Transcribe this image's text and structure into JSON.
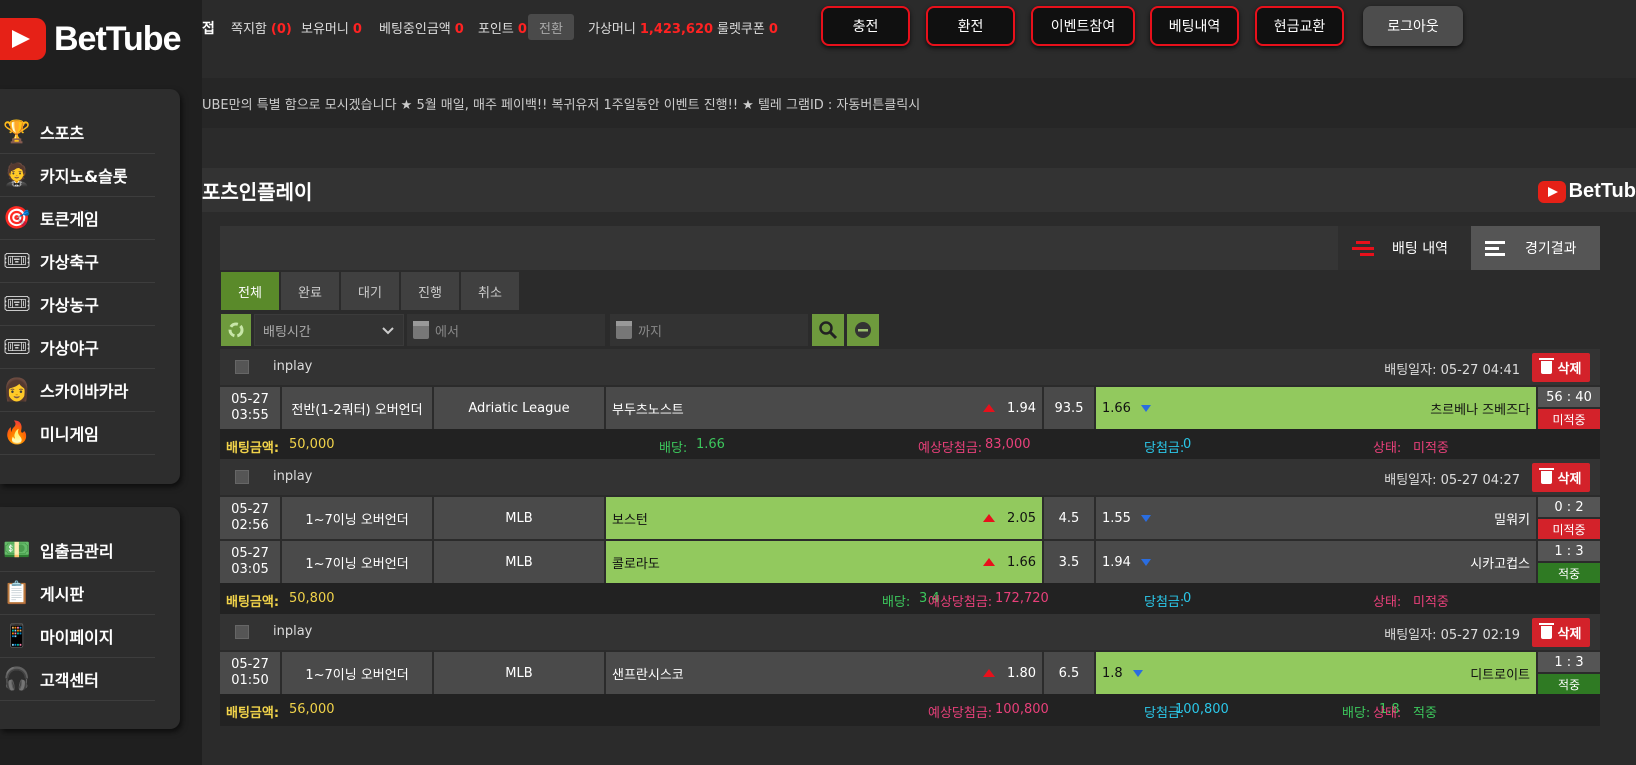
{
  "brand": {
    "logo_text": "BetTube",
    "mini_logo_text": "BetTub"
  },
  "sidebar": {
    "main": [
      {
        "label": "스포츠",
        "icon": "trophy-icon",
        "glyph": "🏆"
      },
      {
        "label": "카지노&슬롯",
        "icon": "dealer-icon",
        "glyph": "🤵"
      },
      {
        "label": "토큰게임",
        "icon": "target-icon",
        "glyph": "🎯"
      },
      {
        "label": "가상축구",
        "icon": "ticket-icon",
        "glyph": "🎟"
      },
      {
        "label": "가상농구",
        "icon": "ticket-icon",
        "glyph": "🎟"
      },
      {
        "label": "가상야구",
        "icon": "ticket-icon",
        "glyph": "🎟"
      },
      {
        "label": "스카이바카라",
        "icon": "avatar-icon",
        "glyph": "👩"
      },
      {
        "label": "미니게임",
        "icon": "flame-icon",
        "glyph": "🔥"
      }
    ],
    "sub": [
      {
        "label": "입출금관리",
        "icon": "money-icon",
        "glyph": "💵"
      },
      {
        "label": "게시판",
        "icon": "board-icon",
        "glyph": "📋"
      },
      {
        "label": "마이페이지",
        "icon": "phone-icon",
        "glyph": "📱"
      },
      {
        "label": "고객센터",
        "icon": "support-icon",
        "glyph": "🎧"
      }
    ]
  },
  "topbar": {
    "cut_label": "접",
    "messages_label": "쪽지함",
    "messages_value": "(0)",
    "money_label": "보유머니",
    "money_value": "0",
    "betting_label": "베팅중인금액",
    "betting_value": "0",
    "points_label": "포인트",
    "points_value": "0",
    "convert_label": "전환",
    "virtual_label": "가상머니",
    "virtual_value": "1,423,620",
    "coupon_label": "룰렛쿠폰",
    "coupon_value": "0",
    "buttons": [
      "충전",
      "환전",
      "이벤트참여",
      "베팅내역",
      "현금교환"
    ],
    "logout_label": "로그아웃"
  },
  "ticker": {
    "text": "UBE만의 특별 함으로 모시겠습니다 ★ 5월 매일, 매주 페이백!! 복귀유저 1주일동안 이벤트 진행!! ★ 텔레 그램ID : 자동버튼클릭시"
  },
  "page": {
    "title": "포츠인플레이"
  },
  "history": {
    "bet_history_label": "배팅 내역",
    "results_label": "경기결과"
  },
  "tabs": [
    "전체",
    "완료",
    "대기",
    "진행",
    "취소"
  ],
  "filter": {
    "select_value": "배팅시간",
    "from_placeholder": "에서",
    "to_placeholder": "까지"
  },
  "labels": {
    "inplay": "inplay",
    "delete": "삭제",
    "amount": "배팅금액:",
    "odds": "배당:",
    "expected": "예상당첨금:",
    "won": "당첨금:",
    "status": "상태:"
  },
  "bets": [
    {
      "date": "배팅일자: 05-27 04:41",
      "games": [
        {
          "time_date": "05-27",
          "time_clock": "03:55",
          "type": "전반(1-2쿼터) 오버언더",
          "league": "Adriatic League",
          "home": "부두츠노스트",
          "home_odd": "1.94",
          "line": "93.5",
          "away_odd": "1.66",
          "away": "츠르베나 즈베즈다",
          "pick": "away",
          "score": "56 : 40",
          "status": "미적중",
          "status_color": "red"
        }
      ],
      "amount": "50,000",
      "odds": "1.66",
      "expected": "83,000",
      "won": "0",
      "status": "미적중",
      "status_color": "#e8407a"
    },
    {
      "date": "배팅일자: 05-27 04:27",
      "games": [
        {
          "time_date": "05-27",
          "time_clock": "02:56",
          "type": "1~7이닝 오버언더",
          "league": "MLB",
          "home": "보스턴",
          "home_odd": "2.05",
          "line": "4.5",
          "away_odd": "1.55",
          "away": "밀워키",
          "pick": "home",
          "score": "0 : 2",
          "status": "미적중",
          "status_color": "red"
        },
        {
          "time_date": "05-27",
          "time_clock": "03:05",
          "type": "1~7이닝 오버언더",
          "league": "MLB",
          "home": "콜로라도",
          "home_odd": "1.66",
          "line": "3.5",
          "away_odd": "1.94",
          "away": "시카고컵스",
          "pick": "home",
          "score": "1 : 3",
          "status": "적중",
          "status_color": "green"
        }
      ],
      "amount": "50,800",
      "odds": "3.4",
      "expected": "172,720",
      "won": "0",
      "status": "미적중",
      "status_color": "#e8407a"
    },
    {
      "date": "배팅일자: 05-27 02:19",
      "games": [
        {
          "time_date": "05-27",
          "time_clock": "01:50",
          "type": "1~7이닝 오버언더",
          "league": "MLB",
          "home": "샌프란시스코",
          "home_odd": "1.80",
          "line": "6.5",
          "away_odd": "1.8",
          "away": "디트로이트",
          "pick": "away",
          "score": "1 : 3",
          "status": "적중",
          "status_color": "green"
        }
      ],
      "amount": "56,000",
      "odds": "1.8",
      "expected": "100,800",
      "won": "100,800",
      "status": "적중",
      "status_color": "#3cc65c"
    }
  ]
}
